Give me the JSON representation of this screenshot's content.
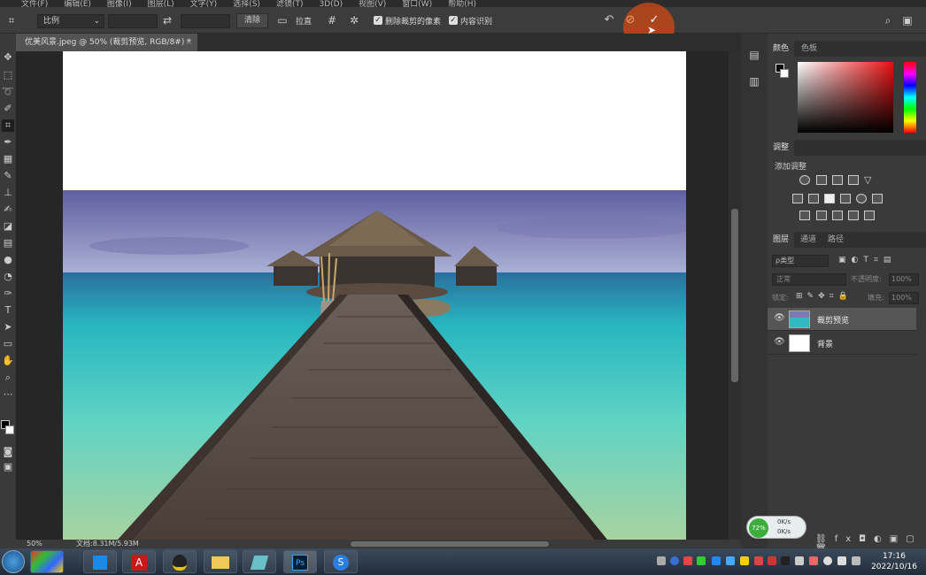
{
  "menu": [
    "文件(F)",
    "编辑(E)",
    "图像(I)",
    "图层(L)",
    "文字(Y)",
    "选择(S)",
    "滤镜(T)",
    "3D(D)",
    "视图(V)",
    "窗口(W)",
    "帮助(H)"
  ],
  "options": {
    "ratio_label": "比例",
    "clear_label": "清除",
    "straighten_label": "拉直",
    "delete_cropped_label": "删除裁剪的像素",
    "content_aware_label": "内容识别"
  },
  "document": {
    "tab_title": "优美风景.jpeg @ 50% (裁剪预览, RGB/8#) *",
    "zoom": "50%",
    "doc_info": "文档:8.31M/5.93M"
  },
  "panels": {
    "color_tabs": [
      "颜色",
      "色板"
    ],
    "adjust_tab": "调整",
    "adjust_title": "添加调整",
    "layers_tabs": [
      "图层",
      "通道",
      "路径"
    ],
    "kind_label": "ρ类型",
    "blend_mode": "正常",
    "opacity_label": "不透明度:",
    "opacity_value": "100%",
    "lock_label": "锁定:",
    "fill_label": "填充:",
    "fill_value": "100%",
    "layers": [
      {
        "name": "裁剪预览",
        "selected": true
      },
      {
        "name": "背景",
        "selected": false
      }
    ]
  },
  "netmonitor": {
    "percent": "72%",
    "up": "0K/s",
    "down": "0K/s"
  },
  "taskbar": {
    "time": "17:16",
    "date": "2022/10/16"
  },
  "colors": {
    "accent_orange": "#c8501e",
    "ps_blue": "#31a8ff"
  }
}
